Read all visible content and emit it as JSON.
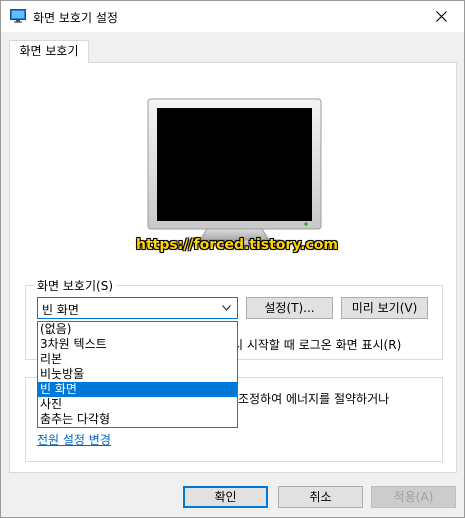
{
  "window": {
    "title": "화면 보호기 설정"
  },
  "tab": {
    "label": "화면 보호기"
  },
  "watermark": "https://forced.tistory.com",
  "screensaver_group": {
    "legend": "화면 보호기(S)",
    "selected_value": "빈 화면",
    "settings_button": "설정(T)...",
    "preview_button": "미리 보기(V)",
    "resume_text_visible": "시 시작할 때 로그온 화면 표시(R)"
  },
  "dropdown": {
    "options": [
      "(없음)",
      "3차원 텍스트",
      "리본",
      "비눗방울",
      "빈 화면",
      "사진",
      "춤추는 다각형"
    ],
    "selected_index": 4
  },
  "power_group": {
    "text_visible": "조정하여 에너지를 절약하거나",
    "link": "전원 설정 변경"
  },
  "footer": {
    "ok_button": "확인",
    "cancel_button": "취소",
    "apply_button": "적용(A)"
  },
  "colors": {
    "accent": "#0078d7",
    "link": "#0066cc",
    "watermark": "#ffd400"
  }
}
